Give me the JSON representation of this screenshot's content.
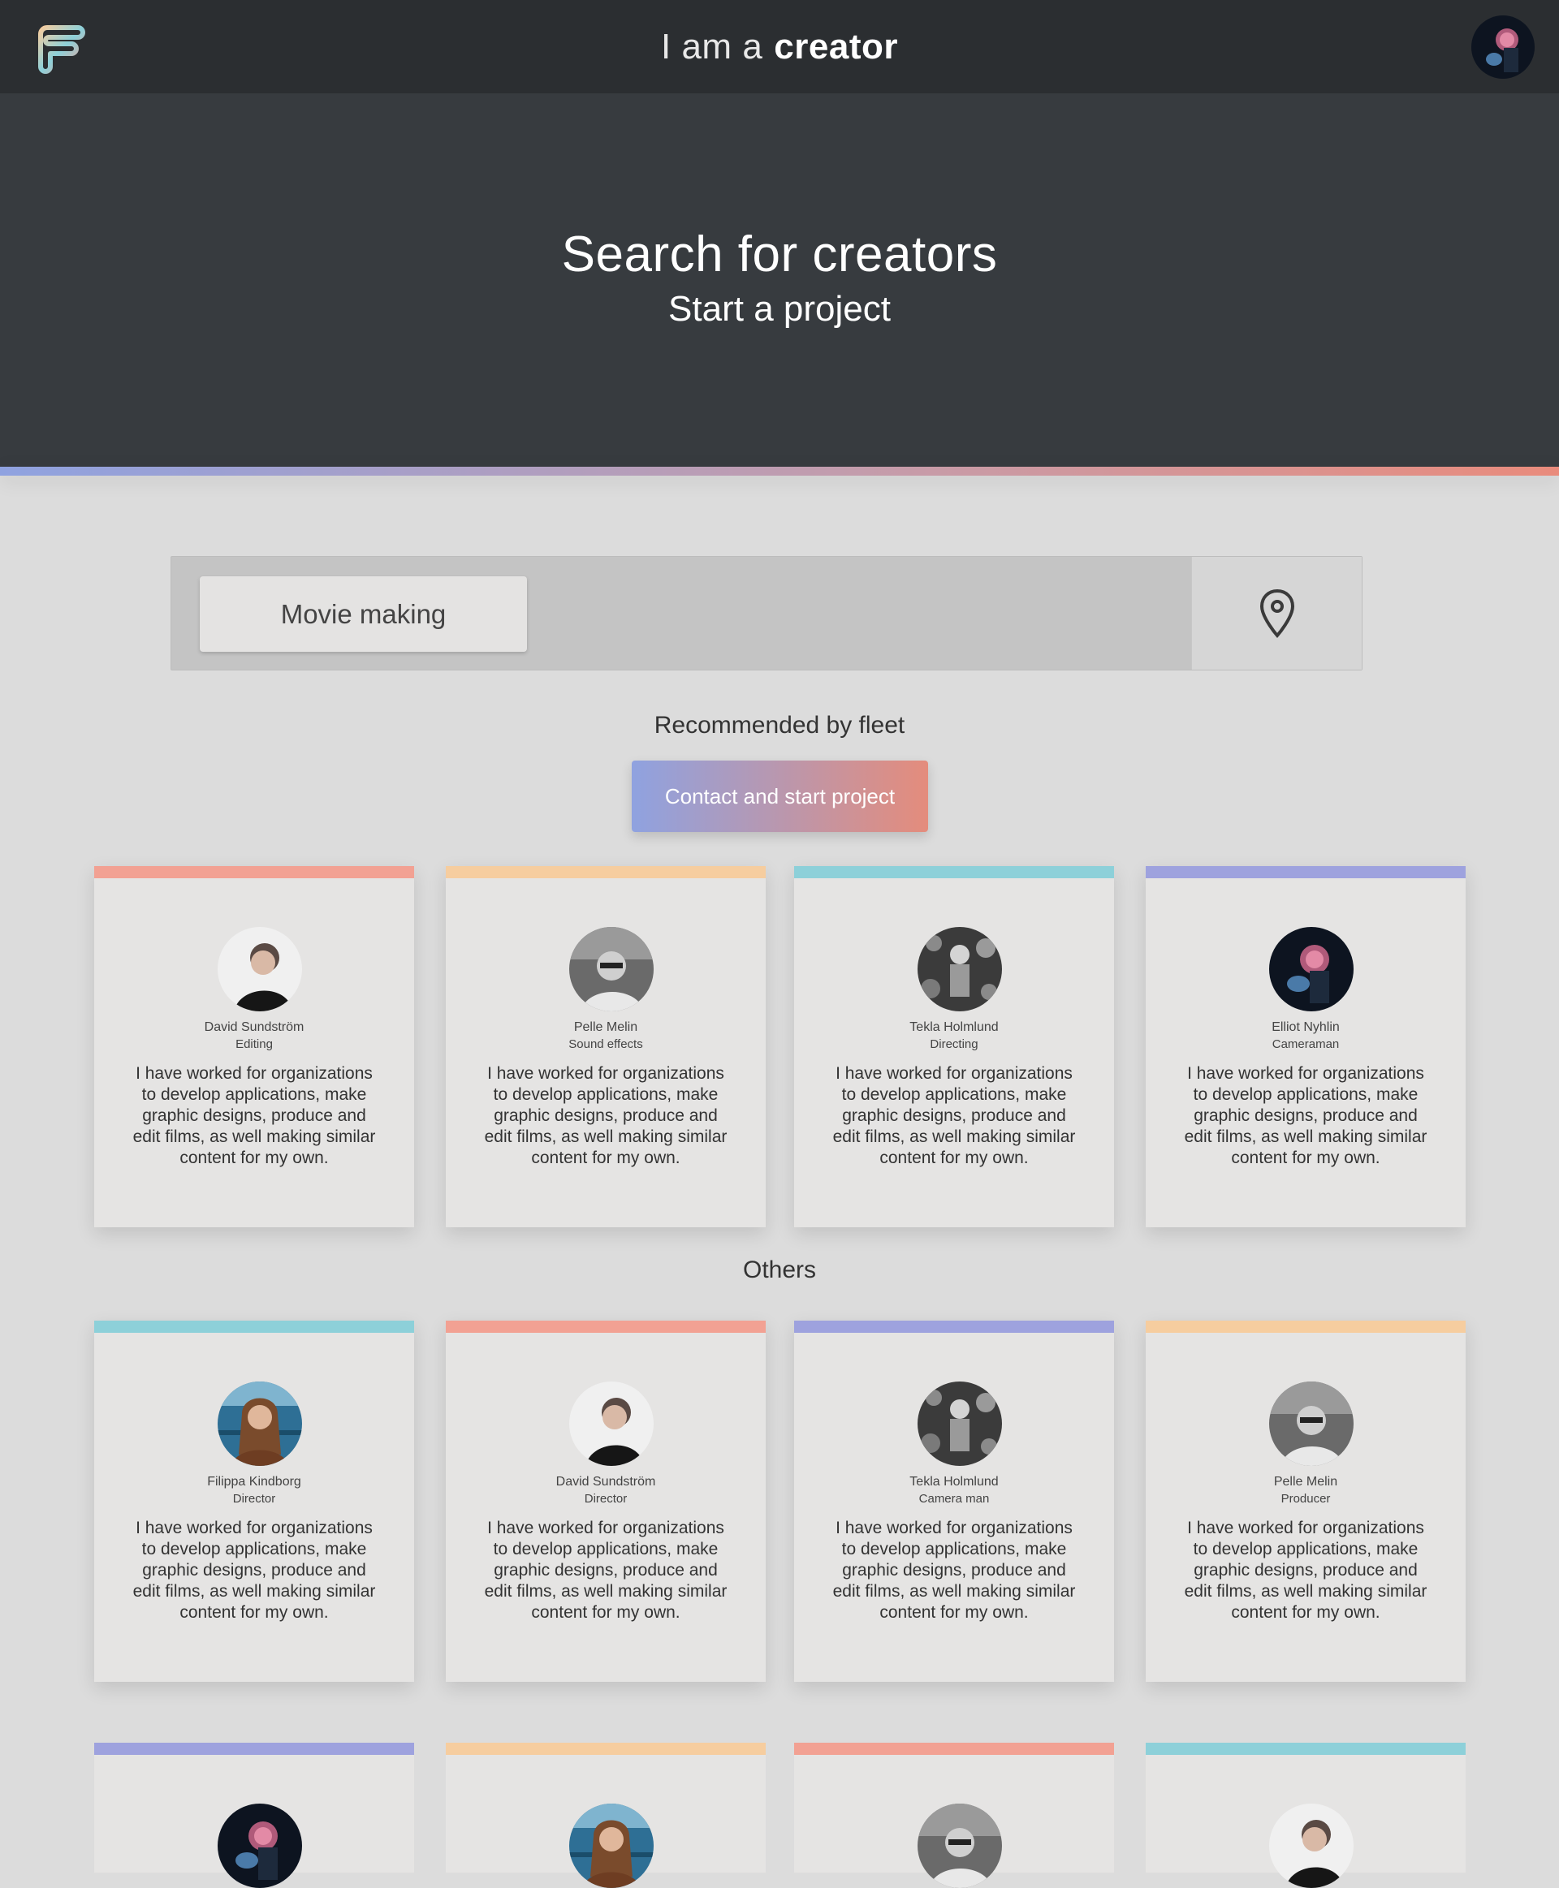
{
  "topbar": {
    "brand_light": "I am a",
    "brand_bold": "creator"
  },
  "hero": {
    "title": "Search for creators",
    "subtitle": "Start a project"
  },
  "search": {
    "chip_label": "Movie making",
    "location_icon": "map-pin-icon"
  },
  "recommended": {
    "label": "Recommended by fleet",
    "cta_label": "Contact and start project"
  },
  "others": {
    "label": "Others"
  },
  "colors": {
    "salmon": "#f2a193",
    "peach": "#f6cd9f",
    "teal": "#8dd0d9",
    "lavender": "#9ea2de",
    "gradient_start": "#8fa2e0",
    "gradient_end": "#e48c7c"
  },
  "bio_text": "I have worked for organizations to develop applications, make graphic designs, produce and edit films, as well making similar content for my own.",
  "recommended_cards": [
    {
      "name": "David Sundström",
      "role": "Editing",
      "stripe": "salmon"
    },
    {
      "name": "Pelle Melin",
      "role": "Sound effects",
      "stripe": "peach"
    },
    {
      "name": "Tekla Holmlund",
      "role": "Directing",
      "stripe": "teal"
    },
    {
      "name": "Elliot Nyhlin",
      "role": "Cameraman",
      "stripe": "lavender"
    }
  ],
  "other_cards": [
    {
      "name": "Filippa Kindborg",
      "role": "Director",
      "stripe": "teal"
    },
    {
      "name": "David Sundström",
      "role": "Director",
      "stripe": "salmon"
    },
    {
      "name": "Tekla Holmlund",
      "role": "Camera man",
      "stripe": "lavender"
    },
    {
      "name": "Pelle Melin",
      "role": "Producer",
      "stripe": "peach"
    }
  ]
}
